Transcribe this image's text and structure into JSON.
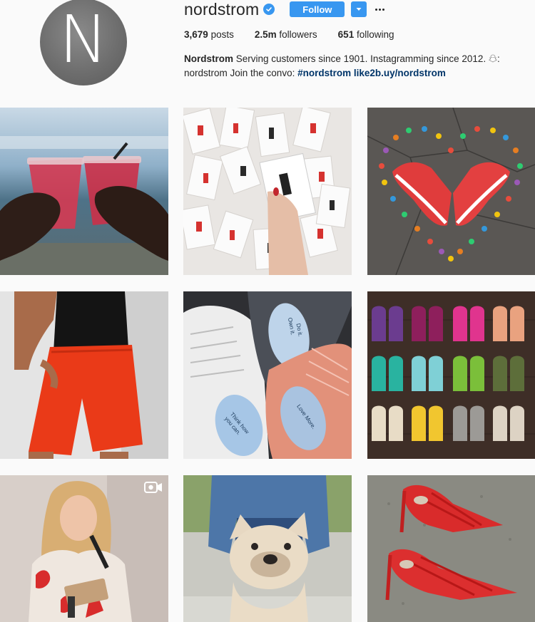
{
  "profile": {
    "avatar_letter": "N",
    "username": "nordstrom",
    "follow_label": "Follow",
    "stats": {
      "posts_count": "3,679",
      "posts_label": "posts",
      "followers_count": "2.5m",
      "followers_label": "followers",
      "following_count": "651",
      "following_label": "following"
    },
    "bio": {
      "name": "Nordstrom",
      "text1": " Serving customers since 1901. Instagramming since 2012. ",
      "text2": ": nordstrom Join the convo: ",
      "hashtag": "#nordstrom",
      "space": " ",
      "website": "like2b.uy/nordstrom"
    }
  },
  "icons": {
    "verified": "verified-badge-icon",
    "dropdown": "chevron-down-icon",
    "more": "more-options-icon",
    "snapchat": "snapchat-ghost-icon",
    "video": "video-camera-icon"
  },
  "colors": {
    "accent": "#3897f0",
    "link": "#003569",
    "background": "#fafafa",
    "text": "#262626"
  },
  "posts": [
    {
      "subject": "drinks-toast",
      "type": "photo"
    },
    {
      "subject": "playing-cards",
      "type": "photo"
    },
    {
      "subject": "red-sneakers-heart",
      "type": "photo"
    },
    {
      "subject": "red-shorts",
      "type": "photo"
    },
    {
      "subject": "sneaker-insoles",
      "type": "photo"
    },
    {
      "subject": "baby-moccasins",
      "type": "photo"
    },
    {
      "subject": "speaker-microphone",
      "type": "video"
    },
    {
      "subject": "french-bulldog",
      "type": "photo"
    },
    {
      "subject": "red-heels",
      "type": "photo"
    }
  ],
  "post_text": {
    "insole_1": "Do it.",
    "insole_2": "Own it.",
    "insole_3": "Think how",
    "insole_4": "you can.",
    "insole_5": "Love More."
  }
}
